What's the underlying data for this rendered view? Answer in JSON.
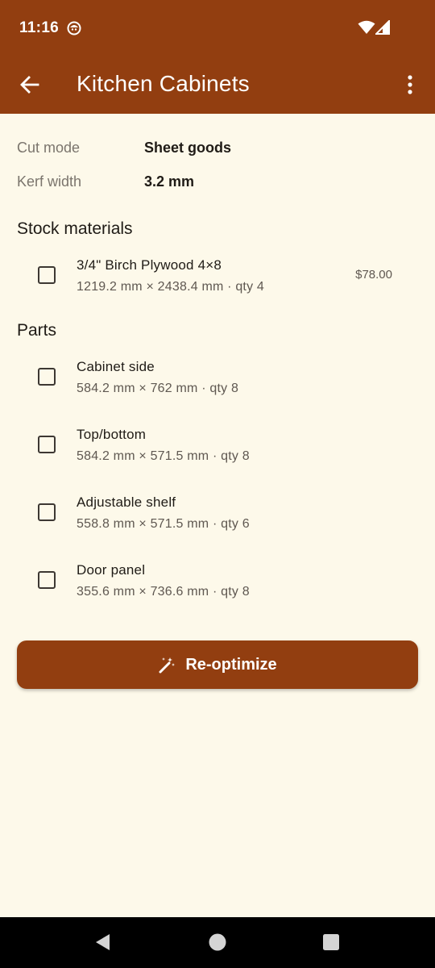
{
  "status_bar": {
    "time": "11:16"
  },
  "app_bar": {
    "title": "Kitchen Cabinets"
  },
  "settings": [
    {
      "label": "Cut mode",
      "value": "Sheet goods"
    },
    {
      "label": "Kerf width",
      "value": "3.2 mm"
    }
  ],
  "stock": {
    "title": "Stock materials",
    "items": [
      {
        "name": "3/4\" Birch Plywood 4×8",
        "detail": "1219.2 mm × 2438.4 mm · qty 4",
        "price": "$78.00"
      }
    ]
  },
  "parts": {
    "title": "Parts",
    "items": [
      {
        "name": "Cabinet side",
        "detail": "584.2 mm × 762 mm · qty 8"
      },
      {
        "name": "Top/bottom",
        "detail": "584.2 mm × 571.5 mm · qty 8"
      },
      {
        "name": "Adjustable shelf",
        "detail": "558.8 mm × 571.5 mm · qty 6"
      },
      {
        "name": "Door panel",
        "detail": "355.6 mm × 736.6 mm · qty 8"
      }
    ]
  },
  "actions": {
    "reoptimize_label": "Re-optimize"
  },
  "colors": {
    "primary": "#923e10",
    "background": "#fdf9ea"
  },
  "icons": {
    "back": "arrow-left-icon",
    "more": "more-vertical-icon",
    "reoptimize": "magic-wand-icon"
  }
}
